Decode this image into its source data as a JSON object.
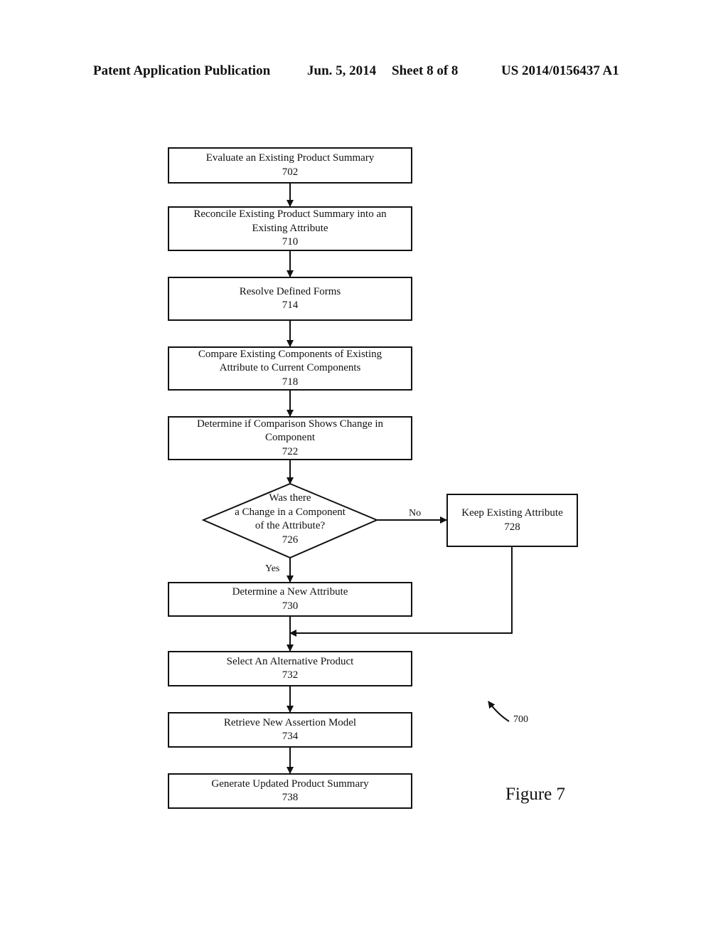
{
  "header": {
    "publication": "Patent Application Publication",
    "date": "Jun. 5, 2014",
    "sheet": "Sheet 8 of 8",
    "number": "US 2014/0156437 A1"
  },
  "figure": {
    "label": "Figure 7",
    "reference": "700"
  },
  "steps": [
    {
      "id": "702",
      "lines": [
        "Evaluate an Existing Product Summary"
      ]
    },
    {
      "id": "710",
      "lines": [
        "Reconcile Existing Product Summary into an",
        "Existing Attribute"
      ]
    },
    {
      "id": "714",
      "lines": [
        "Resolve Defined Forms"
      ]
    },
    {
      "id": "718",
      "lines": [
        "Compare Existing Components of Existing",
        "Attribute to Current Components"
      ]
    },
    {
      "id": "722",
      "lines": [
        "Determine if Comparison Shows Change in",
        "Component"
      ]
    },
    {
      "id": "728",
      "lines": [
        "Keep Existing Attribute"
      ]
    },
    {
      "id": "730",
      "lines": [
        "Determine a New Attribute"
      ]
    },
    {
      "id": "732",
      "lines": [
        "Select An Alternative Product"
      ]
    },
    {
      "id": "734",
      "lines": [
        "Retrieve New Assertion Model"
      ]
    },
    {
      "id": "738",
      "lines": [
        "Generate Updated Product Summary"
      ]
    }
  ],
  "decision": {
    "id": "726",
    "lines": [
      "Was there",
      "a Change in a Component",
      "of the Attribute?"
    ],
    "yes_label": "Yes",
    "no_label": "No"
  }
}
